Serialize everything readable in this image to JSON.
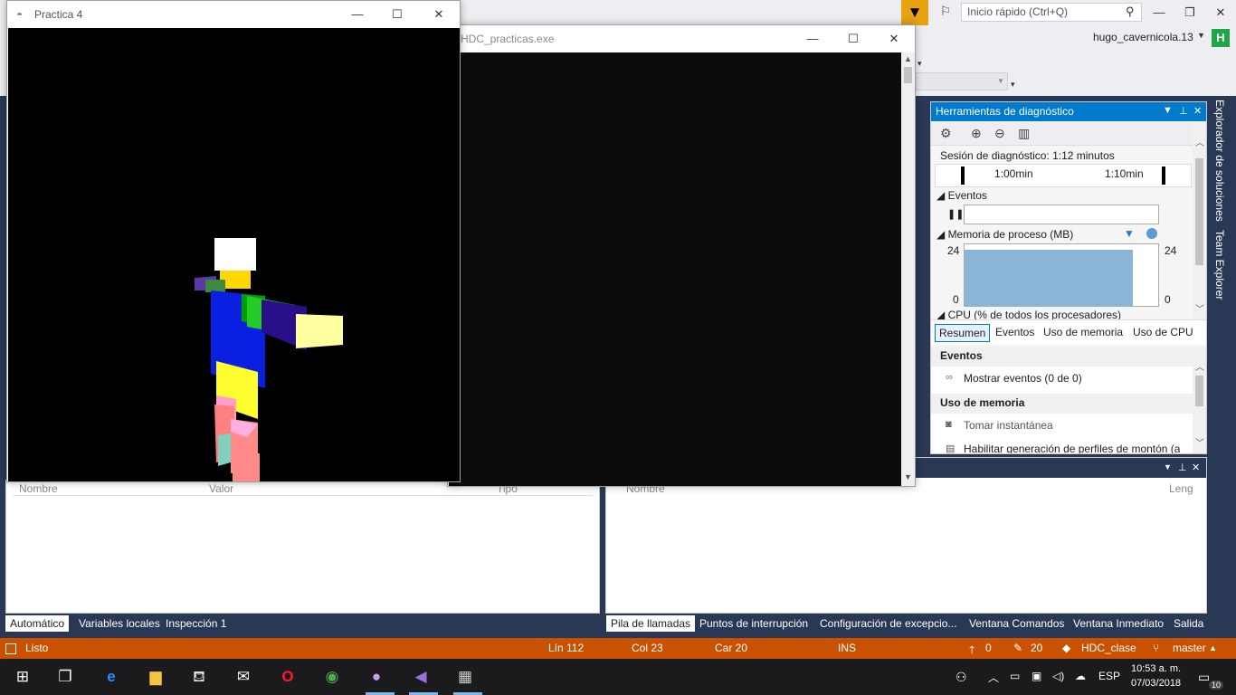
{
  "vs": {
    "quick_launch_placeholder": "Inicio rápido (Ctrl+Q)",
    "user_name": "hugo_cavernicola.13",
    "user_initial": "H"
  },
  "practica": {
    "title": "Practica 4"
  },
  "console": {
    "title": "HDC_practicas.exe"
  },
  "diagnostics": {
    "title": "Herramientas de diagnóstico",
    "session": "Sesión de diagnóstico: 1:12 minutos",
    "tick1": "1:00min",
    "tick2": "1:10min",
    "events_label": "Eventos",
    "memory_label": "Memoria de proceso (MB)",
    "mem_max_left": "24",
    "mem_min_left": "0",
    "mem_max_right": "24",
    "mem_min_right": "0",
    "cpu_label": "CPU (% de todos los procesadores)",
    "tabs": [
      "Resumen",
      "Eventos",
      "Uso de memoria",
      "Uso de CPU"
    ],
    "events_section": "Eventos",
    "show_events": "Mostrar eventos (0 de 0)",
    "memory_section": "Uso de memoria",
    "take_snapshot": "Tomar instantánea",
    "heap_profile": "Habilitar generación de perfiles de montón (a"
  },
  "side_tabs": {
    "solution_explorer": "Explorador de soluciones",
    "team_explorer": "Team Explorer"
  },
  "left_panel": {
    "columns": [
      "Nombre",
      "Valor",
      "Tipo"
    ],
    "tabs": [
      "Automático",
      "Variables locales",
      "Inspección 1"
    ]
  },
  "right_panel": {
    "columns": [
      "Nombre",
      "Leng"
    ],
    "tabs": [
      "Pila de llamadas",
      "Puntos de interrupción",
      "Configuración de excepcio...",
      "Ventana Comandos",
      "Ventana Inmediato",
      "Salida"
    ]
  },
  "status": {
    "ready": "Listo",
    "line": "Lín 112",
    "col": "Col 23",
    "char": "Car 20",
    "mode": "INS",
    "up_count": "0",
    "edit_count": "20",
    "repo": "HDC_clase",
    "branch": "master"
  },
  "taskbar": {
    "lang": "ESP",
    "time": "10:53 a. m.",
    "date": "07/03/2018",
    "notif": "10"
  }
}
